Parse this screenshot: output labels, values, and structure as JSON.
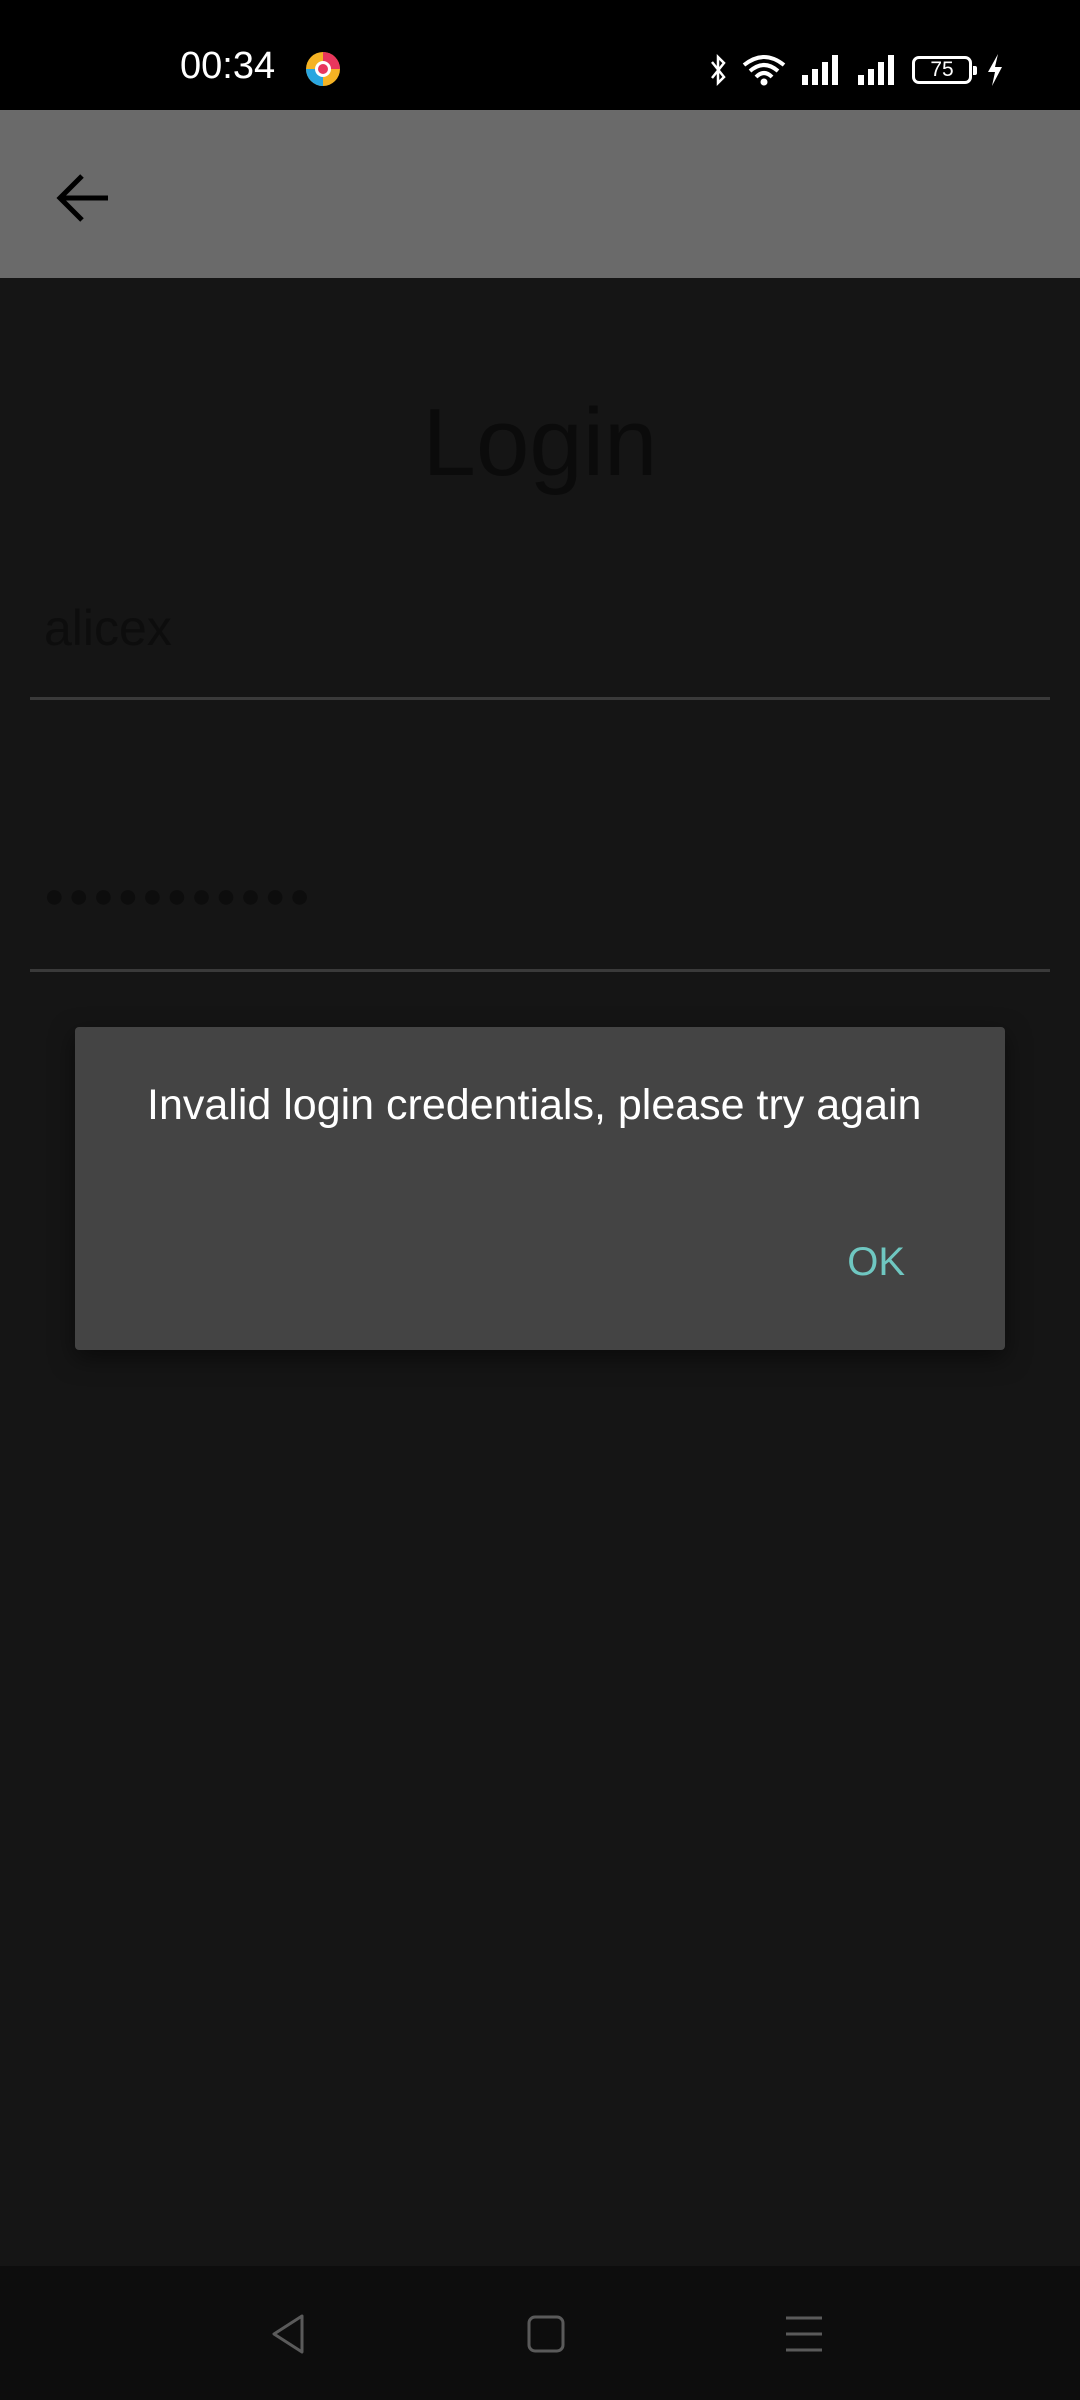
{
  "status_bar": {
    "time": "00:34",
    "battery_level": "75",
    "icons": [
      "app-notification-icon",
      "bluetooth-icon",
      "wifi-icon",
      "signal-icon",
      "signal-icon",
      "battery-icon",
      "charging-icon"
    ]
  },
  "toolbar": {
    "back_icon": "arrow-left-icon"
  },
  "login": {
    "title": "Login",
    "username_value": "alicex",
    "password_value": "●●●●●●●●●●●"
  },
  "dialog": {
    "message": "Invalid login credentials, please try again",
    "ok_label": "OK"
  },
  "nav_bar": {
    "icons": [
      "back-triangle-icon",
      "home-square-icon",
      "menu-lines-icon"
    ]
  },
  "colors": {
    "accent": "#6fc7c1",
    "dialog_bg": "#444444",
    "background": "#151515"
  }
}
